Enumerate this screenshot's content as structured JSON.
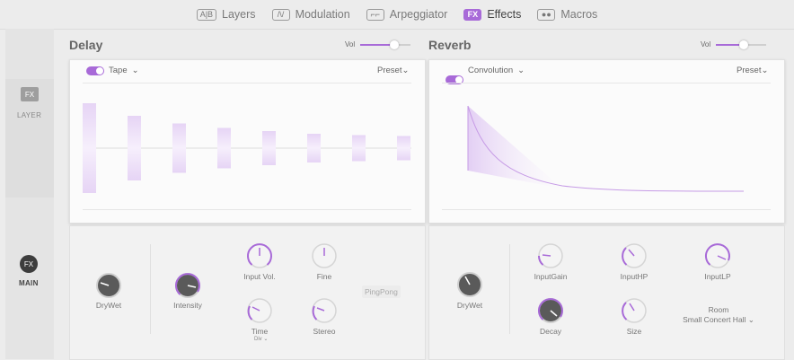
{
  "tabs": [
    {
      "icon": "A|B",
      "label": "Layers",
      "active": false
    },
    {
      "icon": "/\\/",
      "label": "Modulation",
      "active": false
    },
    {
      "icon": "⌐⌐",
      "label": "Arpeggiator",
      "active": false
    },
    {
      "icon": "FX",
      "label": "Effects",
      "active": true
    },
    {
      "icon": "●●",
      "label": "Macros",
      "active": false
    }
  ],
  "left": {
    "layer_badge": "FX",
    "layer_label": "LAYER",
    "main_badge": "FX",
    "main_label": "MAIN"
  },
  "delay": {
    "title": "Delay",
    "vol_label": "Vol",
    "vol_level": 0.62,
    "type": "Tape",
    "preset": "Preset",
    "tap_levels": [
      1.0,
      0.72,
      0.55,
      0.45,
      0.38,
      0.32,
      0.29,
      0.27
    ],
    "drywet": "DryWet",
    "intensity": "Intensity",
    "input_vol": "Input Vol.",
    "fine": "Fine",
    "pingpong": "PingPong",
    "time": "Time",
    "time_sub": "Div ⌄",
    "stereo": "Stereo"
  },
  "reverb": {
    "title": "Reverb",
    "vol_label": "Vol",
    "vol_level": 0.55,
    "type": "Convolution",
    "preset": "Preset",
    "drywet": "DryWet",
    "input_gain": "InputGain",
    "input_hp": "InputHP",
    "input_lp": "InputLP",
    "decay": "Decay",
    "size": "Size",
    "room_label": "Room",
    "room_value": "Small Concert Hall ⌄"
  },
  "colors": {
    "accent": "#a86ad8",
    "bg": "#ececec"
  }
}
